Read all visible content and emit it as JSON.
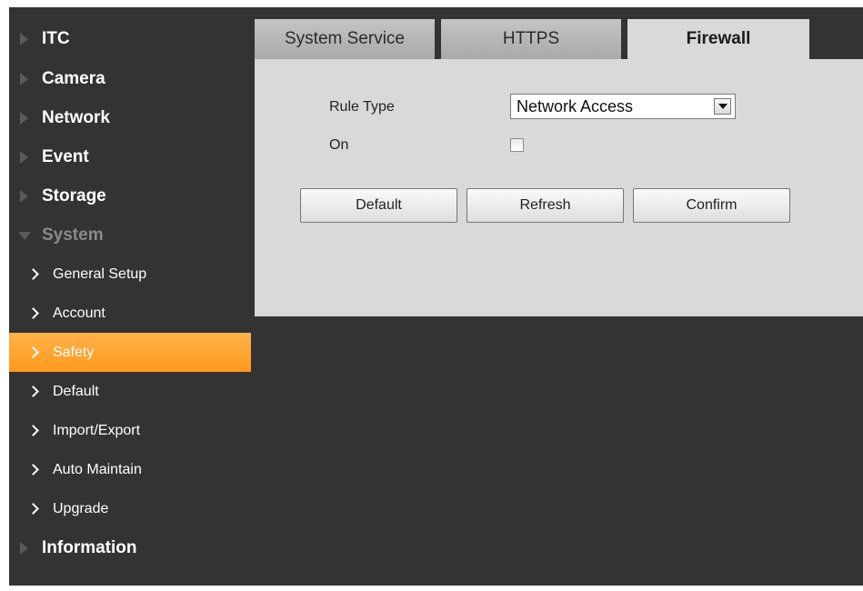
{
  "sidebar": {
    "menu_top": [
      {
        "label": "ITC"
      },
      {
        "label": "Camera"
      },
      {
        "label": "Network"
      },
      {
        "label": "Event"
      },
      {
        "label": "Storage"
      }
    ],
    "system_label": "System",
    "sub_items": [
      {
        "label": "General Setup",
        "active": false
      },
      {
        "label": "Account",
        "active": false
      },
      {
        "label": "Safety",
        "active": true
      },
      {
        "label": "Default",
        "active": false
      },
      {
        "label": "Import/Export",
        "active": false
      },
      {
        "label": "Auto Maintain",
        "active": false
      },
      {
        "label": "Upgrade",
        "active": false
      }
    ],
    "information_label": "Information",
    "active_color": "#ff9a1c"
  },
  "tabs": [
    {
      "label": "System Service",
      "active": false
    },
    {
      "label": "HTTPS",
      "active": false
    },
    {
      "label": "Firewall",
      "active": true
    }
  ],
  "form": {
    "rule_type_label": "Rule Type",
    "rule_type_value": "Network Access",
    "on_label": "On",
    "on_checked": false
  },
  "buttons": {
    "default_label": "Default",
    "refresh_label": "Refresh",
    "confirm_label": "Confirm"
  }
}
